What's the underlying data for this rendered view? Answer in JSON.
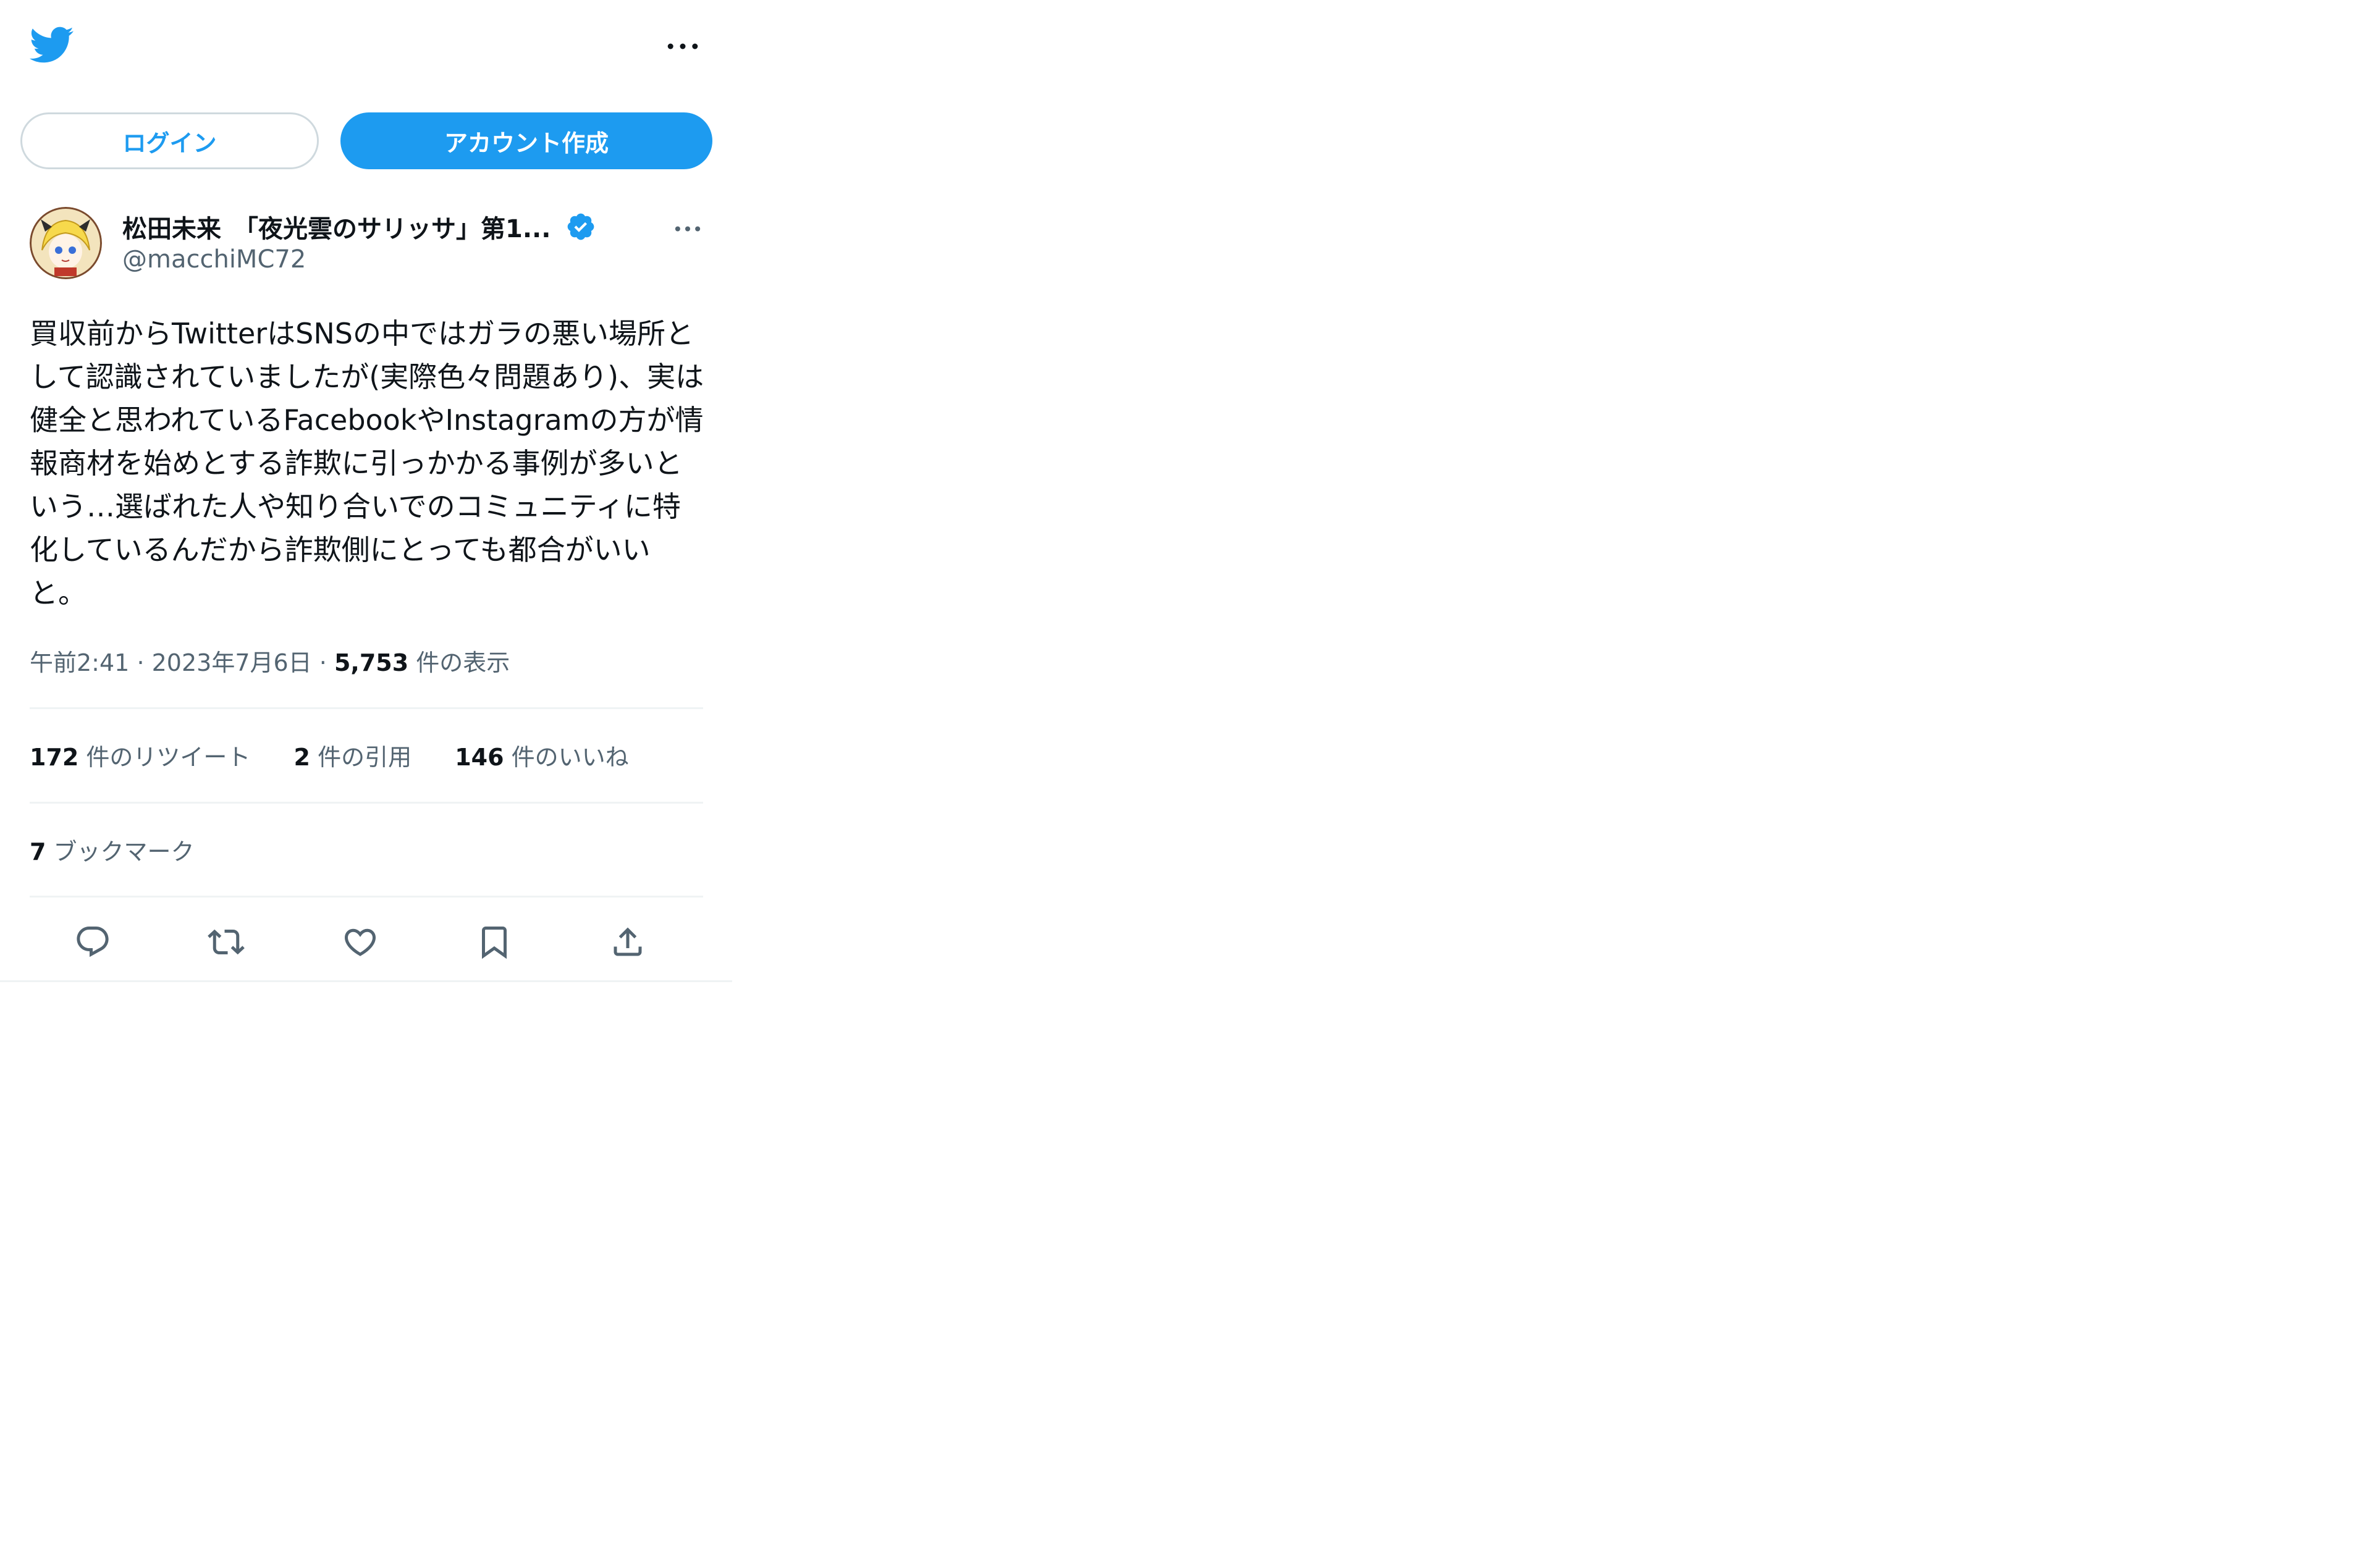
{
  "header": {
    "logo_icon": "twitter-bird-icon",
    "more_icon": "more-horizontal-icon"
  },
  "buttons": {
    "login_label": "ログイン",
    "signup_label": "アカウント作成"
  },
  "tweet": {
    "author": {
      "display_name": "松田未来　「夜光雲のサリッサ」第1...",
      "handle": "@macchiMC72",
      "verified": true,
      "avatar_icon": "user-avatar"
    },
    "text": "買収前からTwitterはSNSの中ではガラの悪い場所として認識されていましたが(実際色々問題あり)、実は健全と思われているFacebookやInstagramの方が情報商材を始めとする詐欺に引っかかる事例が多いという…選ばれた人や知り合いでのコミュニティに特化しているんだから詐欺側にとっても都合がいいと。",
    "time": "午前2:41",
    "separator": "·",
    "date": "2023年7月6日",
    "views_count": "5,753",
    "views_label": "件の表示"
  },
  "stats": {
    "retweets_count": "172",
    "retweets_label": "件のリツイート",
    "quotes_count": "2",
    "quotes_label": "件の引用",
    "likes_count": "146",
    "likes_label": "件のいいね",
    "bookmarks_count": "7",
    "bookmarks_label": "ブックマーク"
  },
  "actions": [
    {
      "icon": "reply-icon"
    },
    {
      "icon": "retweet-icon"
    },
    {
      "icon": "like-icon"
    },
    {
      "icon": "bookmark-icon"
    },
    {
      "icon": "share-icon"
    }
  ],
  "colors": {
    "accent": "#1d9bf0",
    "text": "#0f1419",
    "secondary": "#536471",
    "divider": "#eff3f4"
  }
}
